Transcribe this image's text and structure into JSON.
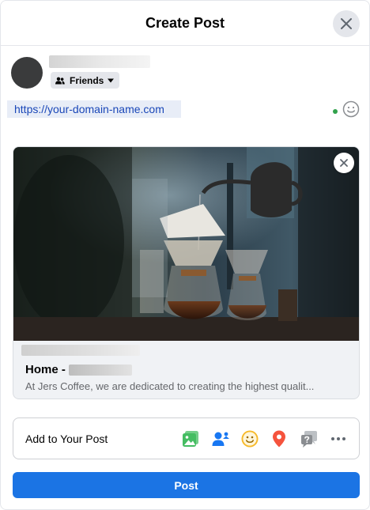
{
  "dialog": {
    "title": "Create Post"
  },
  "composer": {
    "audience_label": "Friends",
    "text": "https://your-domain-name.com"
  },
  "link_preview": {
    "title_prefix": "Home -",
    "description": "At Jers Coffee, we are dedicated to creating the highest qualit..."
  },
  "add_to_post": {
    "label": "Add to Your Post",
    "icons": [
      "photo-video-icon",
      "tag-people-icon",
      "feeling-activity-icon",
      "check-in-icon",
      "question-icon",
      "more-icon"
    ]
  },
  "actions": {
    "post_label": "Post"
  },
  "colors": {
    "primary": "#1b74e4",
    "photo_green": "#45bd62",
    "tag_blue": "#1877f2",
    "feeling_yellow": "#f7b928",
    "checkin_red": "#f5533d"
  }
}
